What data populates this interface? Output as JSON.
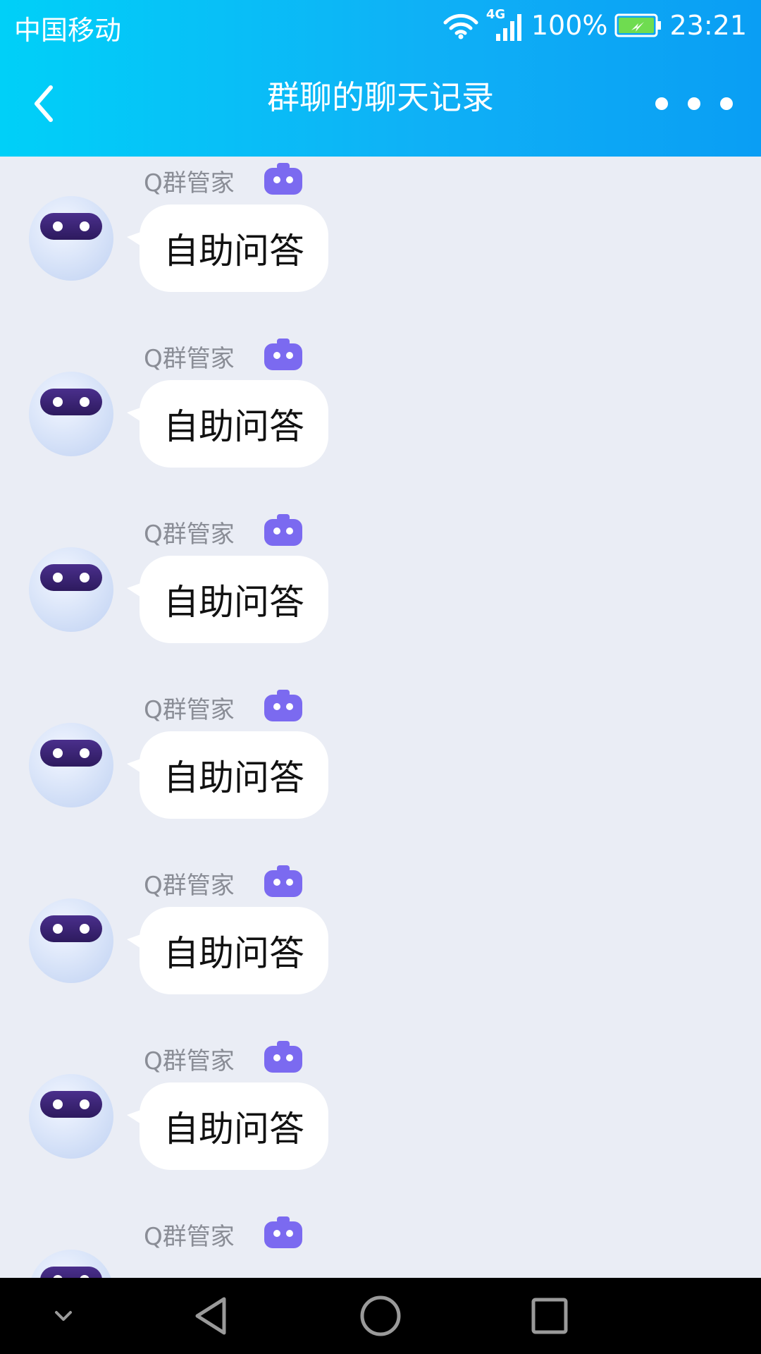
{
  "status_bar": {
    "carrier": "中国移动",
    "network": "4G",
    "battery": "100%",
    "time": "23:21"
  },
  "nav": {
    "title": "群聊的聊天记录"
  },
  "messages": [
    {
      "sender": "Q群管家",
      "text": "自助问答"
    },
    {
      "sender": "Q群管家",
      "text": "自助问答"
    },
    {
      "sender": "Q群管家",
      "text": "自助问答"
    },
    {
      "sender": "Q群管家",
      "text": "自助问答"
    },
    {
      "sender": "Q群管家",
      "text": "自助问答"
    },
    {
      "sender": "Q群管家",
      "text": "自助问答"
    },
    {
      "sender": "Q群管家",
      "text": ""
    }
  ],
  "colors": {
    "header_start": "#00d0f8",
    "header_end": "#0a9ef4",
    "chat_bg": "#eaedf5",
    "bot_badge": "#7b6af0"
  },
  "icons": {
    "back": "chevron-left-icon",
    "more": "more-dots-icon",
    "wifi": "wifi-icon",
    "signal": "signal-icon",
    "battery": "battery-charging-icon",
    "bot_badge": "robot-badge-icon",
    "system_nav": [
      "collapse-icon",
      "back-triangle-icon",
      "home-circle-icon",
      "recents-square-icon"
    ]
  }
}
